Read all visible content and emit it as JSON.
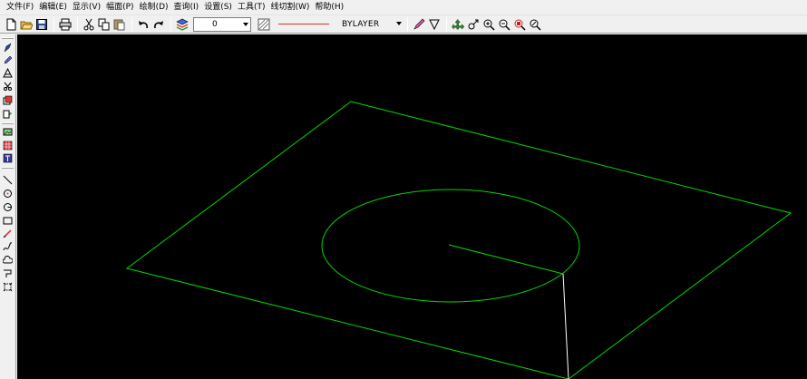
{
  "menu": {
    "items": [
      {
        "label": "文件(F)",
        "name": "menu-file"
      },
      {
        "label": "编辑(E)",
        "name": "menu-edit"
      },
      {
        "label": "显示(V)",
        "name": "menu-view"
      },
      {
        "label": "幅面(P)",
        "name": "menu-page"
      },
      {
        "label": "绘制(D)",
        "name": "menu-draw"
      },
      {
        "label": "查询(I)",
        "name": "menu-query"
      },
      {
        "label": "设置(S)",
        "name": "menu-settings"
      },
      {
        "label": "工具(T)",
        "name": "menu-tools"
      },
      {
        "label": "线切割(W)",
        "name": "menu-wirecut"
      },
      {
        "label": "帮助(H)",
        "name": "menu-help"
      }
    ]
  },
  "toolbar": {
    "layer_value": "0",
    "linetype_value": "BYLAYER",
    "linetype_color": "#ff0000"
  },
  "canvas": {
    "background": "#000000",
    "geometry_color": "#00ff00",
    "line_color": "#ffffff"
  }
}
